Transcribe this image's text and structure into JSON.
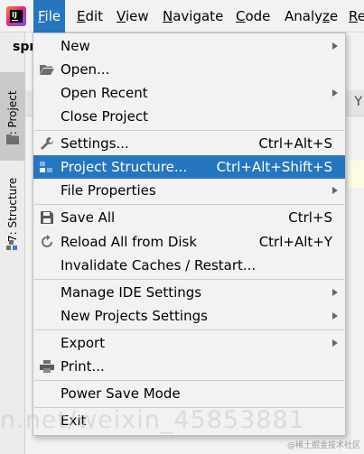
{
  "menubar": {
    "items": [
      {
        "label": "File",
        "mnemonic": "F",
        "rest": "ile"
      },
      {
        "label": "Edit",
        "mnemonic": "E",
        "rest": "dit"
      },
      {
        "label": "View",
        "mnemonic": "V",
        "rest": "iew"
      },
      {
        "label": "Navigate",
        "mnemonic": "N",
        "rest": "avigate"
      },
      {
        "label": "Code",
        "mnemonic": "C",
        "rest": "ode"
      },
      {
        "label": "Analyze",
        "pre": "Analy",
        "mnemonic": "z",
        "rest": "e"
      },
      {
        "label": "Re",
        "mnemonic": "R",
        "rest": "e"
      }
    ],
    "active_index": 0
  },
  "left_strip": {
    "project_tab": "1: Project",
    "structure_tab": "7: Structure"
  },
  "background": {
    "project_title": "spr",
    "right_fragment": "Y"
  },
  "file_menu": {
    "items": [
      {
        "label": "New",
        "has_submenu": true
      },
      {
        "label": "Open...",
        "icon": "folder-open-icon"
      },
      {
        "label": "Open Recent",
        "has_submenu": true
      },
      {
        "label": "Close Project"
      },
      {
        "label": "Settings...",
        "shortcut": "Ctrl+Alt+S",
        "icon": "wrench-icon"
      },
      {
        "label": "Project Structure...",
        "shortcut": "Ctrl+Alt+Shift+S",
        "icon": "project-structure-icon",
        "highlighted": true
      },
      {
        "label": "File Properties",
        "has_submenu": true
      },
      {
        "label": "Save All",
        "shortcut": "Ctrl+S",
        "icon": "save-icon"
      },
      {
        "label": "Reload All from Disk",
        "shortcut": "Ctrl+Alt+Y",
        "icon": "reload-icon"
      },
      {
        "label": "Invalidate Caches / Restart..."
      },
      {
        "label": "Manage IDE Settings",
        "has_submenu": true
      },
      {
        "label": "New Projects Settings",
        "has_submenu": true
      },
      {
        "label": "Export",
        "has_submenu": true
      },
      {
        "label": "Print...",
        "icon": "print-icon"
      },
      {
        "label": "Power Save Mode"
      },
      {
        "label": "Exit"
      }
    ]
  },
  "watermark": "n.net/weixin_45853881",
  "corner_watermark": "@稀土掘金技术社区",
  "colors": {
    "highlight": "#2675bf",
    "menu_bg": "#f2f2f2"
  }
}
